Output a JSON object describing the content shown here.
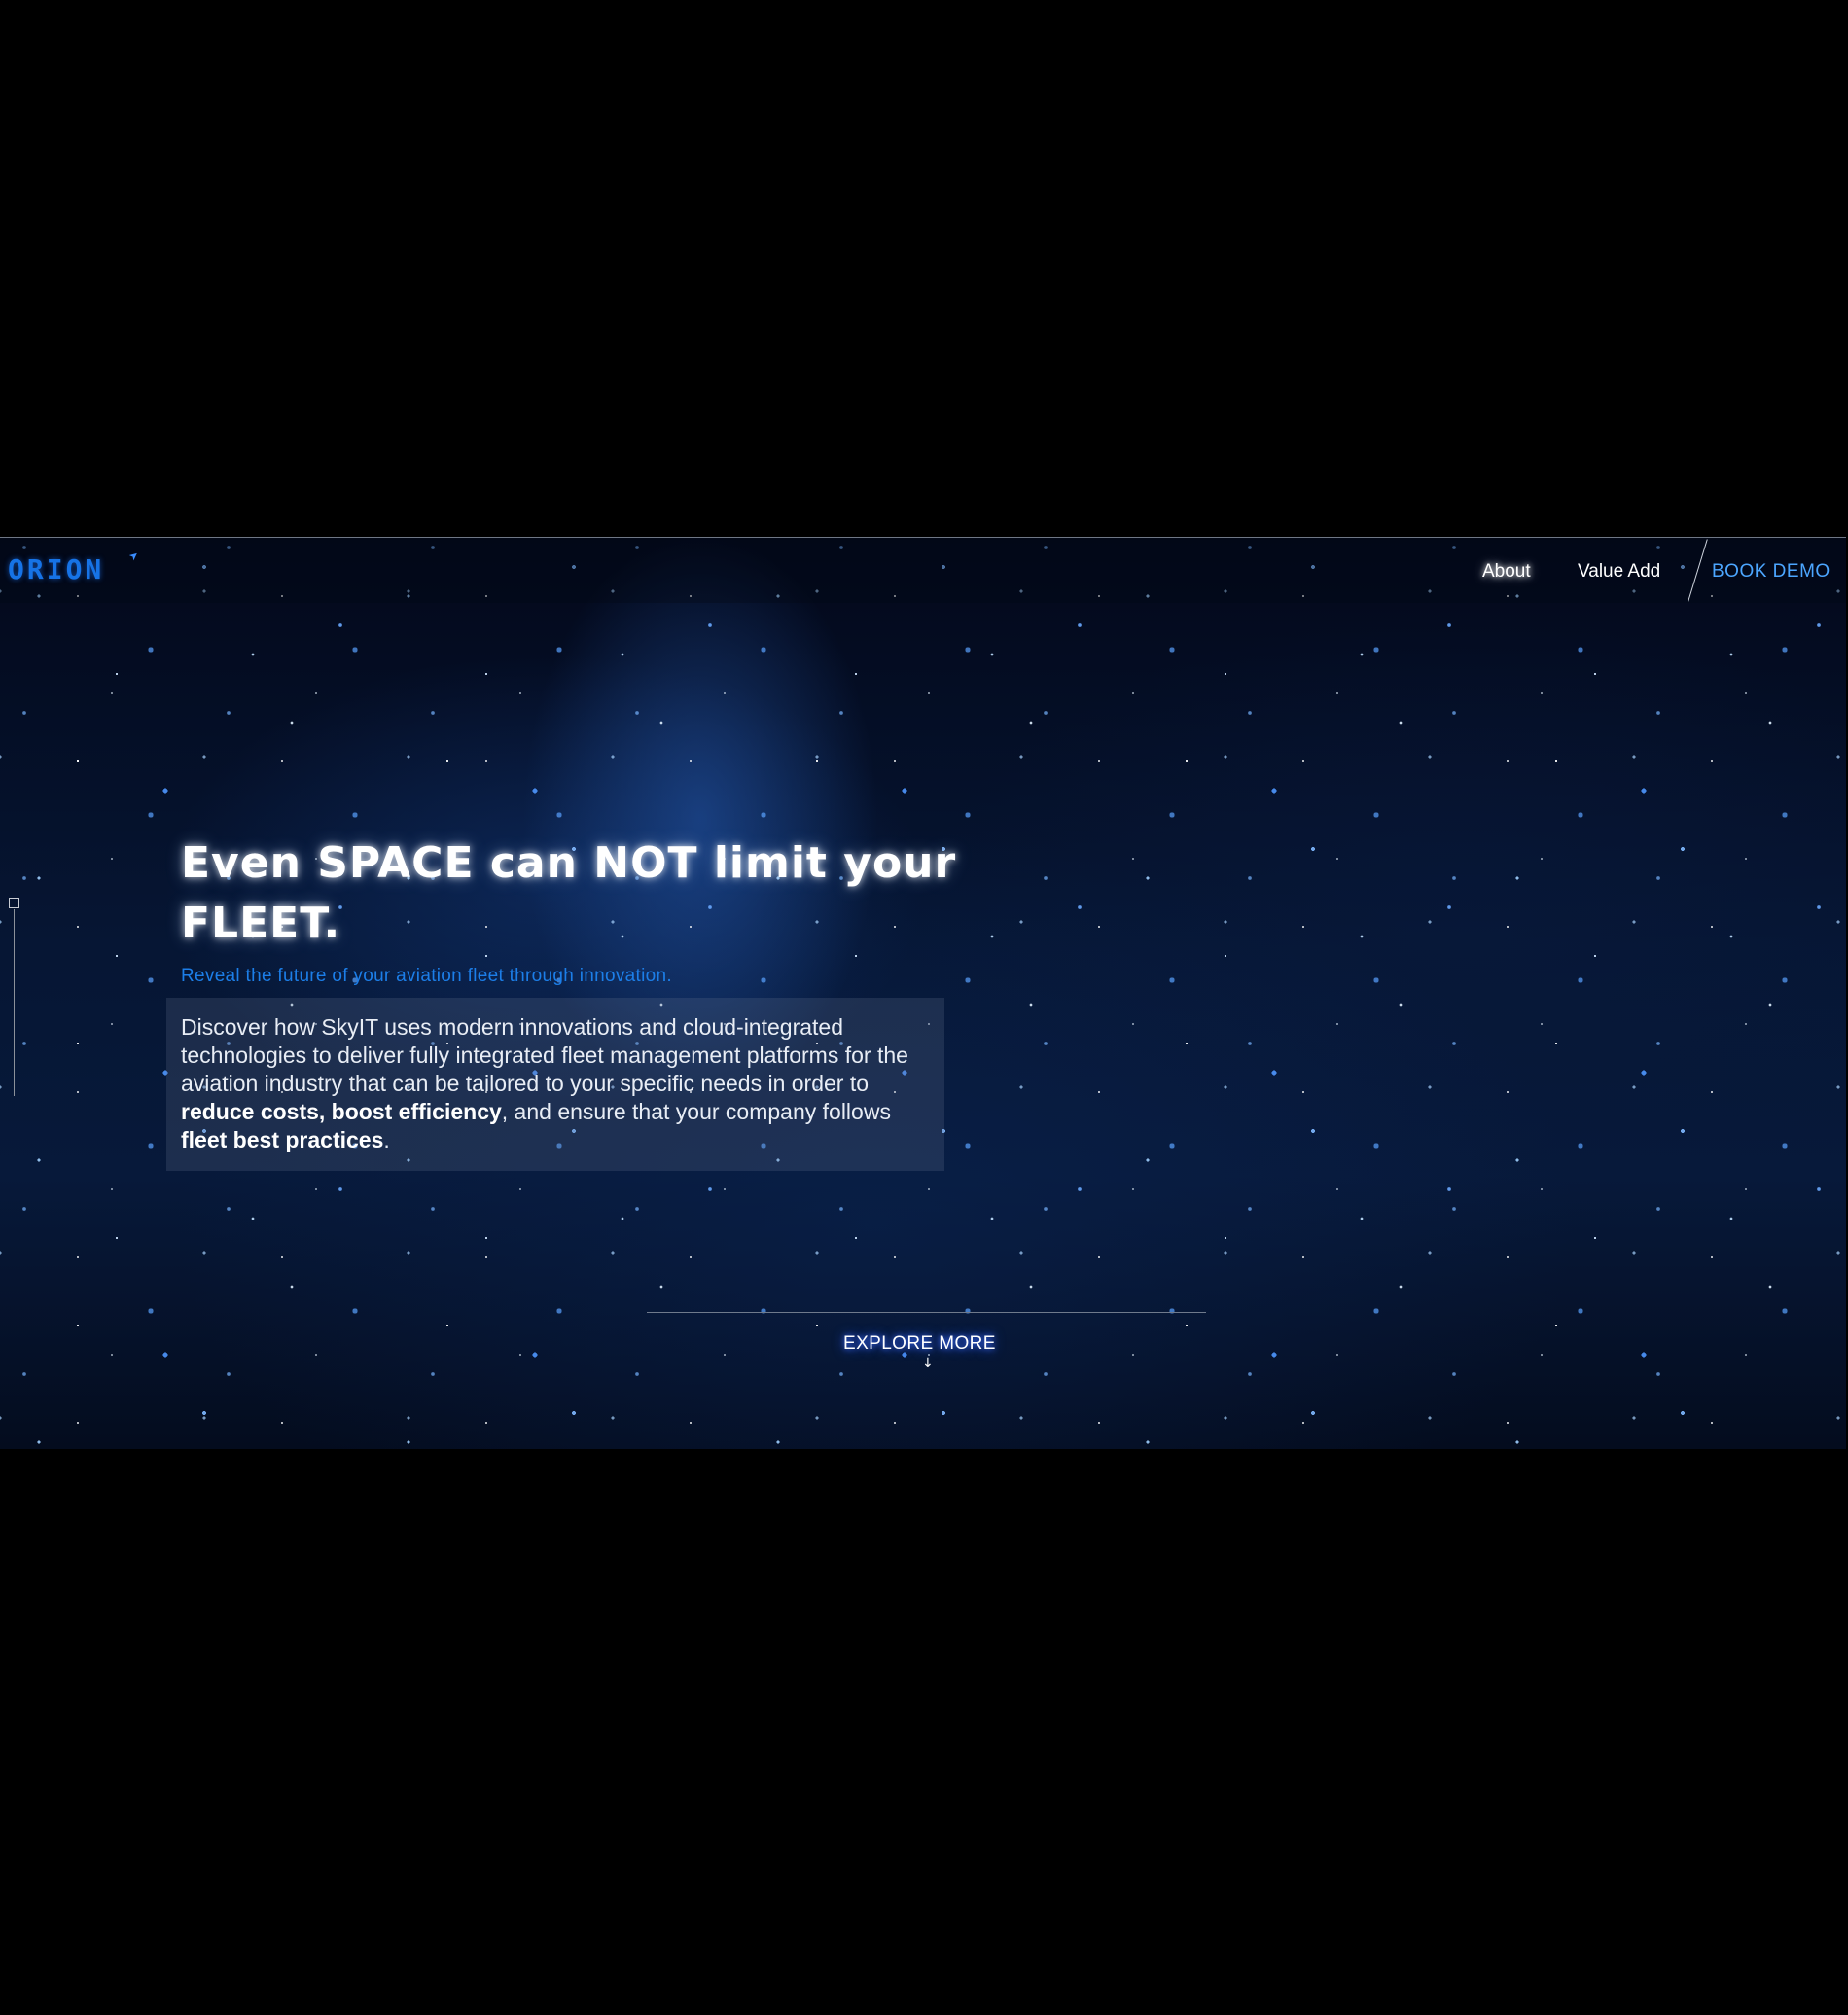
{
  "nav": {
    "logo": "ORION",
    "links": [
      "About",
      "Value Add"
    ],
    "cta": "BOOK DEMO"
  },
  "hero": {
    "headline_line1": "Even SPACE can NOT limit your",
    "headline_line2": "FLEET.",
    "subheadline": "Reveal the future of your aviation fleet through innovation.",
    "description": {
      "part1": "Discover how SkyIT uses modern innovations and cloud-integrated technologies to deliver fully integrated fleet management platforms for the aviation industry that can be tailored to your specific needs in order to ",
      "bold1": "reduce costs, boost efficiency",
      "part2": ", and ensure that your company follows ",
      "bold2": "fleet best practices",
      "part3": "."
    },
    "explore": "EXPLORE MORE",
    "explore_arrow": "↓"
  },
  "icons": {
    "logo_mark": "arrow-icon",
    "scroll": "arrow-down-icon",
    "indicator": "square-indicator-icon"
  },
  "colors": {
    "brand_blue": "#1673e6",
    "cta_blue": "#4ca6ff",
    "subheadline_blue": "#1c7ee8",
    "background": "#000000"
  }
}
